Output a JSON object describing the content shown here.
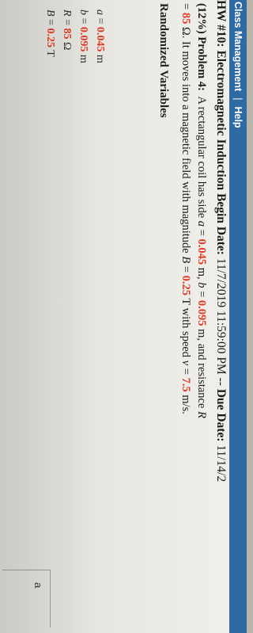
{
  "nav": {
    "class_management": "Class Management",
    "separator": "|",
    "help": "Help"
  },
  "assignment": {
    "title": "HW #10: Electromagnetic Induction",
    "begin_label": "Begin Date:",
    "begin_value": "11/7/2019 11:59:00 PM",
    "dashes": "--",
    "due_label": "Due Date:",
    "due_value": "11/14/2"
  },
  "problem": {
    "label": "(12%) Problem 4:",
    "t1": "A rectangular coil has side",
    "a_sym": "a",
    "a_val": "0.045",
    "t2": "m,",
    "b_sym": "b",
    "b_val": "0.095",
    "t3": "m, and resistance",
    "r_sym": "R",
    "r_val": "85",
    "t4": "Ω. It moves into a magnetic field with magnitude",
    "B_sym": "B",
    "B_val": "0.25",
    "t5": "T with speed",
    "v_sym": "v",
    "v_val": "7.5",
    "t6": "m/s."
  },
  "random_vars": {
    "heading": "Randomized Variables",
    "items": [
      {
        "sym": "a",
        "val": "0.045",
        "unit": "m"
      },
      {
        "sym": "b",
        "val": "0.095",
        "unit": "m"
      },
      {
        "sym": "R",
        "val": "85",
        "unit": "Ω"
      },
      {
        "sym": "B",
        "val": "0.25",
        "unit": "T"
      }
    ]
  },
  "answer_part": {
    "letter": "a"
  },
  "colors": {
    "nav_bar": "#2f6aa3",
    "variable_red": "#d9402b",
    "paper": "#f1f0ec"
  }
}
